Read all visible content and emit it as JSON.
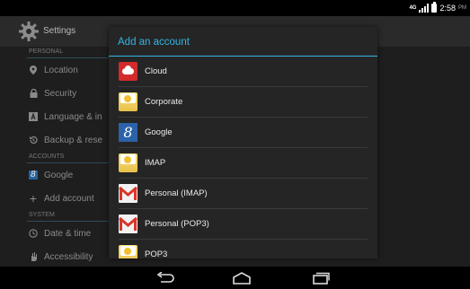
{
  "status": {
    "network": "4G",
    "time": "2:58",
    "ampm": "PM"
  },
  "settings": {
    "title": "Settings",
    "categories": {
      "personal": "PERSONAL",
      "accounts": "ACCOUNTS",
      "system": "SYSTEM"
    },
    "items": {
      "location": "Location",
      "security": "Security",
      "language": "Language & in",
      "backup": "Backup & rese",
      "google": "Google",
      "add_account": "Add account",
      "date_time": "Date & time",
      "accessibility": "Accessibility"
    }
  },
  "dialog": {
    "title": "Add an account",
    "accounts": [
      {
        "label": "Cloud",
        "icon": "cloud-icon"
      },
      {
        "label": "Corporate",
        "icon": "corporate-mail-icon"
      },
      {
        "label": "Google",
        "icon": "google-icon"
      },
      {
        "label": "IMAP",
        "icon": "imap-mail-icon"
      },
      {
        "label": "Personal (IMAP)",
        "icon": "gmail-icon"
      },
      {
        "label": "Personal (POP3)",
        "icon": "gmail-icon"
      },
      {
        "label": "POP3",
        "icon": "pop3-mail-icon"
      }
    ]
  },
  "colors": {
    "accent": "#33b5e5",
    "dialog_bg": "#252525"
  }
}
